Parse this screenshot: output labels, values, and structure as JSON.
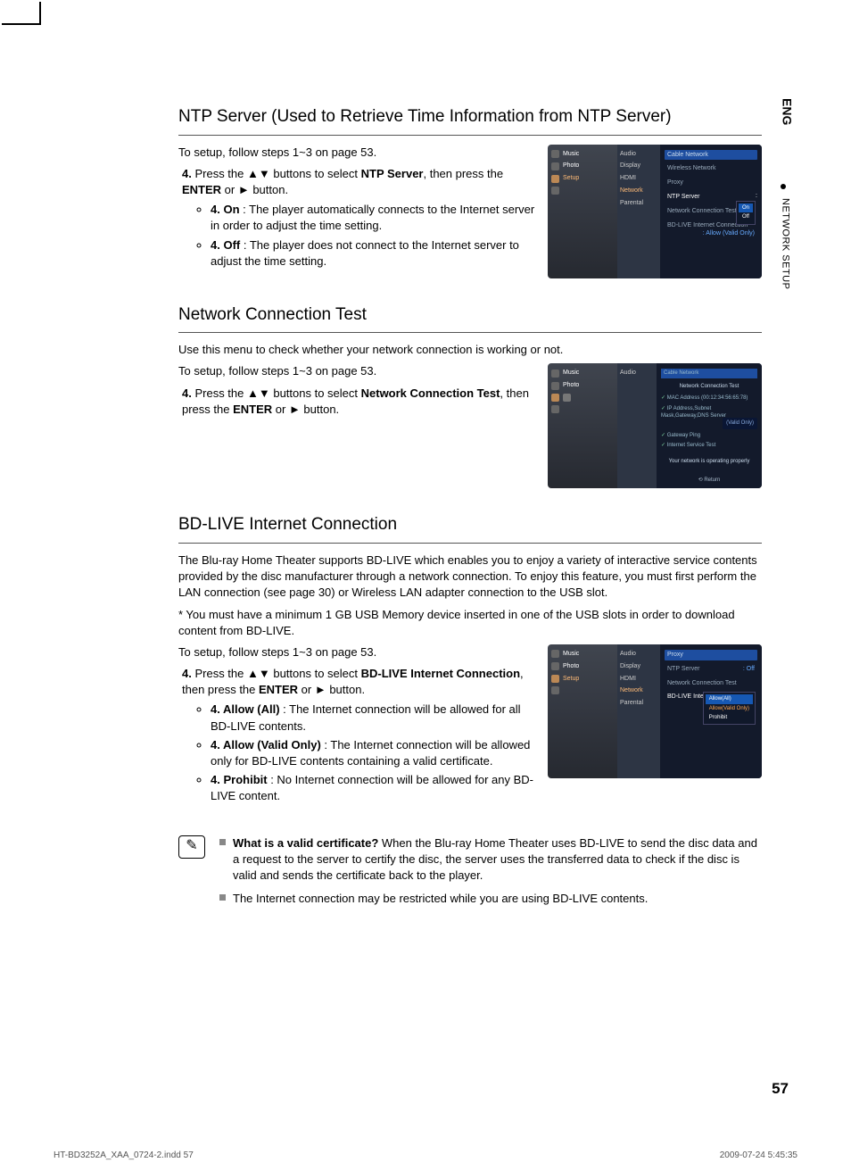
{
  "side": {
    "lang": "ENG",
    "section": "NETWORK SETUP"
  },
  "s1": {
    "title": "NTP Server (Used to Retrieve Time Information from NTP Server)",
    "intro": "To setup, follow steps 1~3 on page 53.",
    "step_pre": "Press the ▲▼ buttons to select ",
    "step_bold": "NTP Server",
    "step_post": ", then press the ",
    "step_enter": "ENTER",
    "step_or": " or ► button.",
    "on_label": "On",
    "on_text": " : The player automatically connects to the Internet server in order to adjust the time setting.",
    "off_label": "Off",
    "off_text": " : The player does not connect to the Internet server to adjust the time setting."
  },
  "shot1": {
    "left": [
      "Music",
      "Photo",
      "Setup"
    ],
    "mid": [
      "Audio",
      "Display",
      "HDMI",
      "Network",
      "Parental"
    ],
    "r1": "Cable Network",
    "r2": "Wireless Network",
    "r3": "Proxy",
    "ntp_label": "NTP Server",
    "ntp_val": "On",
    "ntp_off": "Off",
    "nct": "Network Connection Test",
    "bd_label": "BD-LIVE Internet Connection",
    "bd_val": ": Allow (Valid Only)"
  },
  "s2": {
    "title": "Network Connection Test",
    "intro1": "Use this menu to check whether your network connection is working or not.",
    "intro2": "To setup, follow steps 1~3 on page 53.",
    "step_pre": "Press the ▲▼ buttons to select ",
    "step_bold": "Network Connection Test",
    "step_post": ", then press the ",
    "step_enter": "ENTER",
    "step_or": " or ► button."
  },
  "shot2": {
    "left": [
      "Music",
      "Photo"
    ],
    "mid": [
      "Audio"
    ],
    "title": "Cable Network",
    "sub": "Network Connection Test",
    "c1": "MAC Address (00:12:34:56:65:78)",
    "c2": "IP Address,Subnet Mask,Gateway,DNS Server",
    "c3": "Gateway Ping",
    "c4": "Internet Service Test",
    "badge": "(Valid Only)",
    "msg": "Your network is operating properly",
    "ret": "⟲ Return"
  },
  "s3": {
    "title": "BD-LIVE Internet Connection",
    "p1": "The Blu-ray Home Theater supports BD-LIVE which enables you to enjoy a variety of interactive service contents provided by the disc manufacturer through a network connection. To enjoy this feature, you must first perform the LAN connection (see page 30) or Wireless LAN adapter connection to the USB slot.",
    "p2": "* You must have a minimum 1 GB USB Memory device inserted in one of the USB slots in order to download content from BD-LIVE.",
    "intro": "To setup, follow steps 1~3 on page 53.",
    "step_pre": "Press the ▲▼ buttons to select ",
    "step_bold": "BD-LIVE Internet Connection",
    "step_post": ", then press the ",
    "step_enter": "ENTER",
    "step_or": " or ► button.",
    "a_label": "Allow (All)",
    "a_text": " : The Internet connection will be allowed for all BD-LIVE contents.",
    "v_label": "Allow (Valid Only)",
    "v_text": " : The Internet connection will be allowed only for BD-LIVE contents containing a valid certificate.",
    "p_label": "Prohibit",
    "p_text": " : No Internet connection will be allowed for any BD-LIVE content."
  },
  "shot3": {
    "mid": [
      "Audio",
      "Display",
      "HDMI",
      "Network",
      "Parental"
    ],
    "r1": "Proxy",
    "r2_l": "NTP Server",
    "r2_v": ": Off",
    "r3": "Network Connection Test",
    "bd_label": "BD-LIVE Internet Connection",
    "dd": [
      "Allow(All)",
      "Allow(Valid Only)",
      "Prohibit"
    ]
  },
  "notes": {
    "n1_q": "What is a valid certificate?",
    "n1_t": " When the Blu-ray Home Theater uses BD-LIVE to send the disc data and a request to the server to certify the disc, the server uses the transferred data to check if the disc is valid and sends the certificate back to the player.",
    "n2": "The Internet connection may be restricted while you are using BD-LIVE contents."
  },
  "page_number": "57",
  "footer_left": "HT-BD3252A_XAA_0724-2.indd   57",
  "footer_right": "2009-07-24   5:45:35"
}
